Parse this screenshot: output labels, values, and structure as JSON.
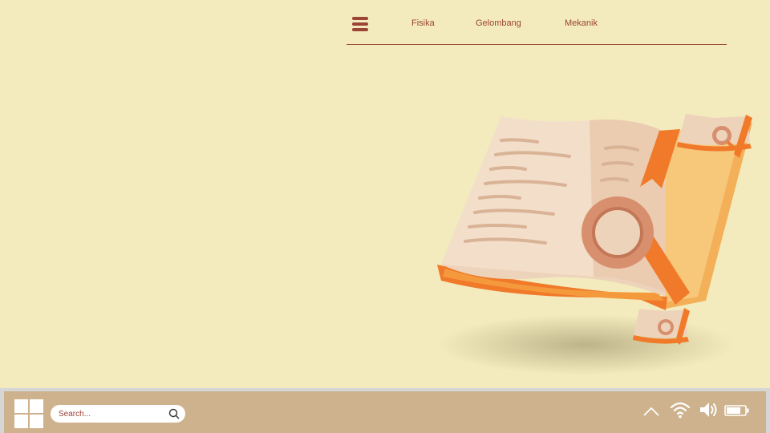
{
  "nav": {
    "menu_icon": "hamburger-menu-icon",
    "links": [
      "Fisika",
      "Gelombang",
      "Mekanik"
    ]
  },
  "hero": {
    "illustration": "open-book-with-magnifying-glass"
  },
  "taskbar": {
    "start_icon": "windows-start-icon",
    "search_placeholder": "Search...",
    "search_icon": "magnifier-icon",
    "tray_icons": [
      "chevron-up-icon",
      "wifi-icon",
      "volume-icon",
      "battery-icon"
    ]
  },
  "colors": {
    "background": "#F3EBBD",
    "accent": "#9B4437",
    "taskbar": "#CDB28D",
    "book_page": "#F2D9C4",
    "book_orange": "#F07A2A",
    "magnifier": "#D88F6E"
  }
}
